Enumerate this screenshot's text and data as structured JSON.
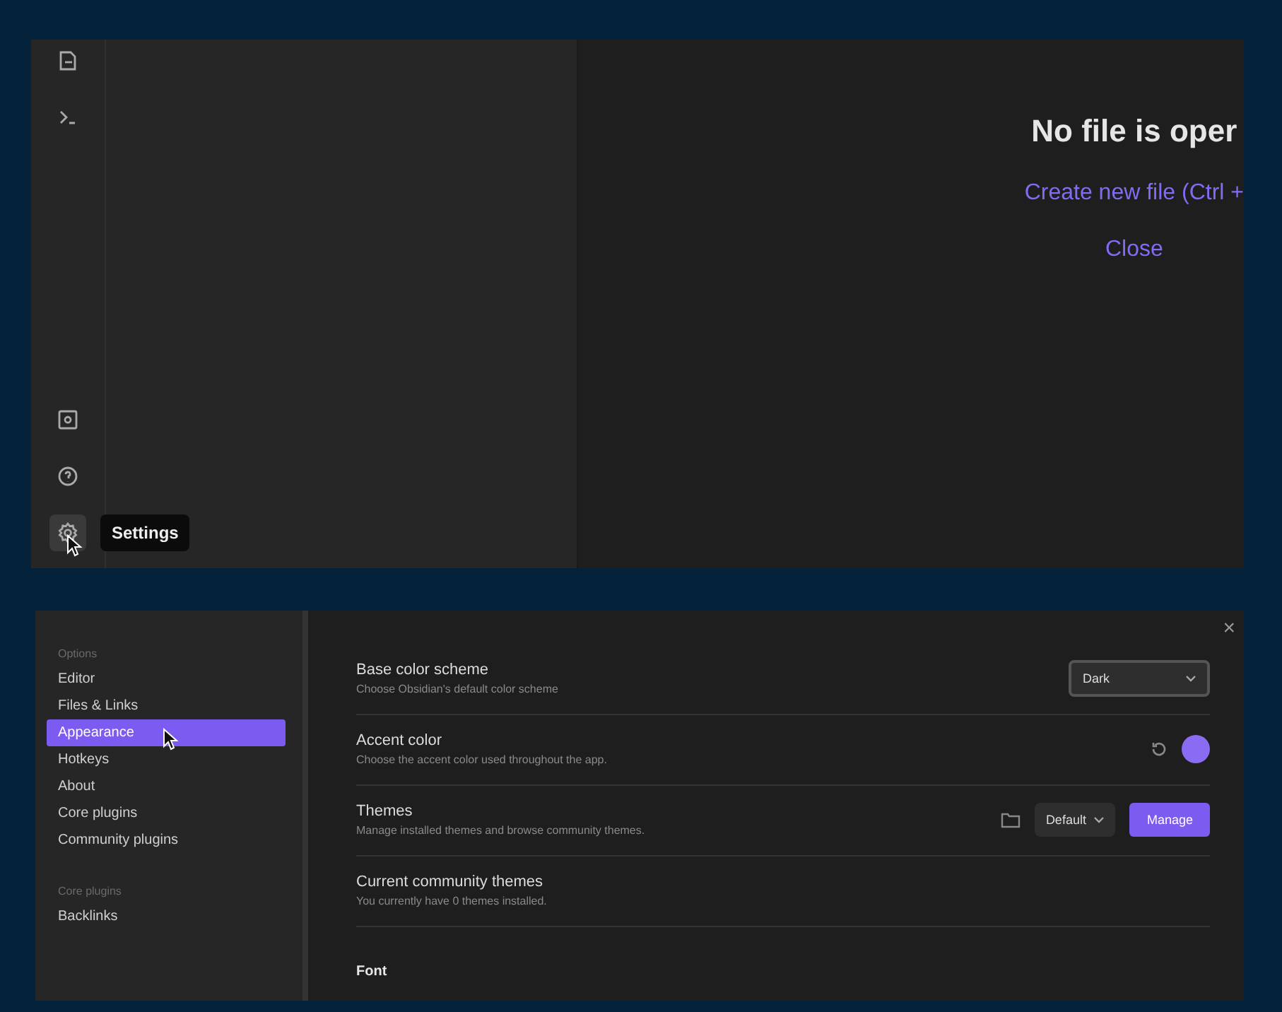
{
  "workspace": {
    "ribbon": {
      "tooltip": "Settings"
    },
    "empty_state": {
      "title": "No file is oper",
      "actions": [
        "Create new file (Ctrl +",
        "Close"
      ]
    }
  },
  "settings": {
    "close": "×",
    "sidebar": [
      {
        "heading": "Options",
        "items": [
          {
            "label": "Editor",
            "selected": false
          },
          {
            "label": "Files & Links",
            "selected": false
          },
          {
            "label": "Appearance",
            "selected": true
          },
          {
            "label": "Hotkeys",
            "selected": false
          },
          {
            "label": "About",
            "selected": false
          },
          {
            "label": "Core plugins",
            "selected": false
          },
          {
            "label": "Community plugins",
            "selected": false
          }
        ]
      },
      {
        "heading": "Core plugins",
        "items": [
          {
            "label": "Backlinks",
            "selected": false
          }
        ]
      }
    ],
    "rows": [
      {
        "kind": "dropdown",
        "title": "Base color scheme",
        "description": "Choose Obsidian's default color scheme",
        "value": "Dark"
      },
      {
        "kind": "color",
        "title": "Accent color",
        "description": "Choose the accent color used throughout the app.",
        "color": "#8a6cf2"
      },
      {
        "kind": "themes",
        "title": "Themes",
        "description": "Manage installed themes and browse community themes.",
        "value": "Default",
        "button": "Manage"
      },
      {
        "kind": "info",
        "title": "Current community themes",
        "description": "You currently have 0 themes installed."
      }
    ],
    "section": "Font"
  }
}
